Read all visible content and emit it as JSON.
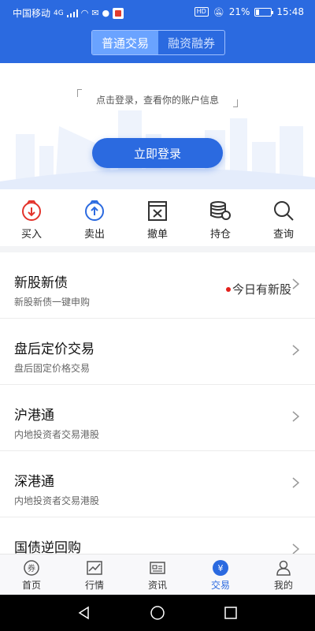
{
  "status_bar": {
    "carrier": "中国移动",
    "network": "4G",
    "battery": "21%",
    "battery_level": 0.21,
    "time": "15:48",
    "hd": "HD"
  },
  "header": {
    "tabs": [
      {
        "label": "普通交易",
        "active": true
      },
      {
        "label": "融资融券",
        "active": false
      }
    ]
  },
  "login": {
    "hint": "点击登录，查看你的账户信息",
    "button": "立即登录"
  },
  "actions": [
    {
      "label": "买入",
      "icon": "buy-icon",
      "color": "#e3332b"
    },
    {
      "label": "卖出",
      "icon": "sell-icon",
      "color": "#2b6ae0"
    },
    {
      "label": "撤单",
      "icon": "cancel-order-icon",
      "color": "#333333"
    },
    {
      "label": "持仓",
      "icon": "holdings-icon",
      "color": "#333333"
    },
    {
      "label": "查询",
      "icon": "search-icon",
      "color": "#333333"
    }
  ],
  "list": [
    {
      "title": "新股新债",
      "subtitle": "新股新债一键申购",
      "extra": "今日有新股"
    },
    {
      "title": "盘后定价交易",
      "subtitle": "盘后固定价格交易"
    },
    {
      "title": "沪港通",
      "subtitle": "内地投资者交易港股"
    },
    {
      "title": "深港通",
      "subtitle": "内地投资者交易港股"
    },
    {
      "title": "国债逆回购",
      "subtitle": ""
    }
  ],
  "tabbar": [
    {
      "label": "首页",
      "icon": "home-icon",
      "active": false
    },
    {
      "label": "行情",
      "icon": "market-icon",
      "active": false
    },
    {
      "label": "资讯",
      "icon": "news-icon",
      "active": false
    },
    {
      "label": "交易",
      "icon": "trade-icon",
      "active": true
    },
    {
      "label": "我的",
      "icon": "profile-icon",
      "active": false
    }
  ],
  "colors": {
    "primary": "#2b6ae0",
    "buy": "#e3332b",
    "alert_dot": "#e3201b"
  }
}
